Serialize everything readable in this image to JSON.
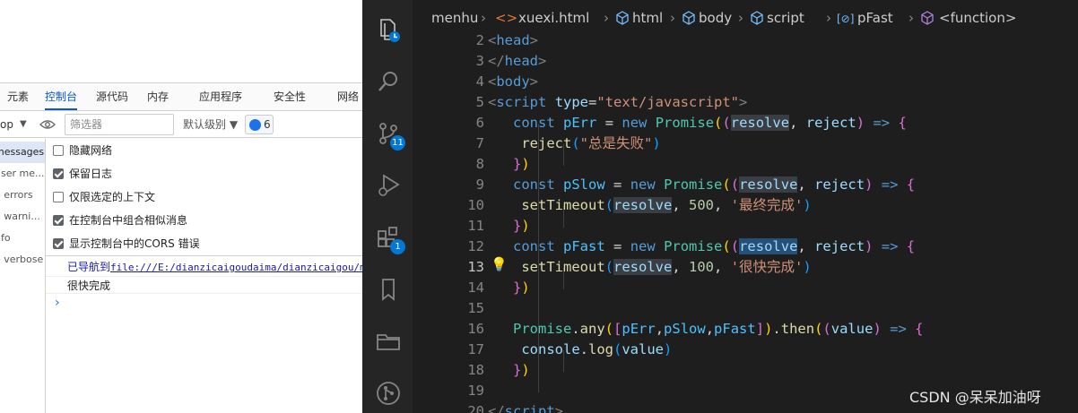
{
  "devtools": {
    "tabs": [
      "元素",
      "控制台",
      "源代码",
      "内存",
      "应用程序",
      "安全性",
      "网络"
    ],
    "active_tab": "控制台",
    "toolbar": {
      "context": "op",
      "filter_placeholder": "筛选器",
      "levels": "默认级别 ▼",
      "message_count": "6"
    },
    "sidebar": [
      "messages",
      "user me...",
      "o errors",
      "o warni...",
      "nfo",
      "o verbose"
    ],
    "settings": [
      {
        "label": "隐藏网络",
        "checked": false
      },
      {
        "label": "保留日志",
        "checked": true
      },
      {
        "label": "仅限选定的上下文",
        "checked": false
      },
      {
        "label": "在控制台中组合相似消息",
        "checked": true
      },
      {
        "label": "显示控制台中的CORS 错误",
        "checked": true
      }
    ],
    "console": {
      "nav_prefix": "已导航到",
      "nav_link": "file:///E:/dianzicaigoudaima/dianzicaigou/m",
      "log_output": "很快完成",
      "prompt": "›"
    }
  },
  "vscode": {
    "breadcrumbs": [
      "menhu",
      "xuexi.html",
      "html",
      "body",
      "script",
      "pFast",
      "<function>"
    ],
    "activity_badges": {
      "source_control": "11",
      "extensions": "1"
    },
    "current_line": "13",
    "line_numbers": [
      "2",
      "3",
      "4",
      "5",
      "6",
      "7",
      "8",
      "9",
      "10",
      "11",
      "12",
      "13",
      "14",
      "15",
      "16",
      "17",
      "18",
      "19",
      "20"
    ],
    "watermark": "CSDN @呆呆加油呀",
    "accent": "#0078d4"
  }
}
